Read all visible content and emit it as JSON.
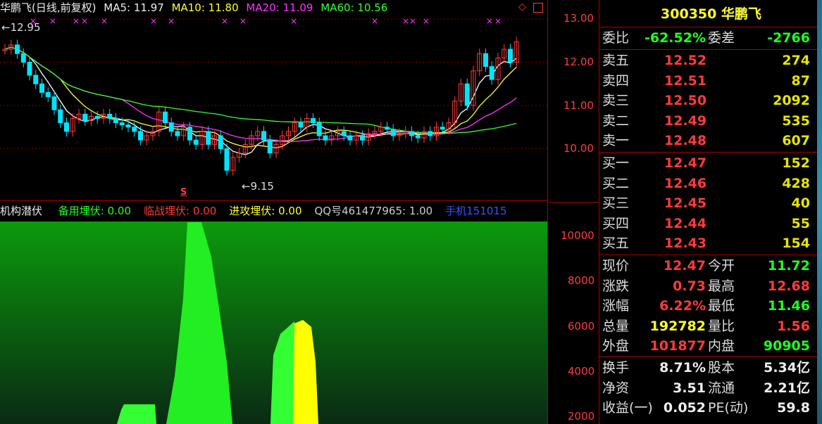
{
  "header": {
    "title": "华鹏飞(日线,前复权)",
    "ma5": "MA5: 11.97",
    "ma10": "MA10: 11.80",
    "ma20": "MA20: 11.09",
    "ma60": "MA60: 10.56",
    "high_marker": "12.95",
    "low_marker": "9.15",
    "s_marker": "S"
  },
  "axis": {
    "price_ticks": [
      "13.00",
      "12.00",
      "11.00",
      "10.00"
    ],
    "ind_ticks": [
      "10000",
      "8000",
      "6000",
      "4000",
      "2000"
    ]
  },
  "indicator": {
    "name": "机构潜伏",
    "items": [
      {
        "label": "备用埋伏: 0.00",
        "color": "#22ff22"
      },
      {
        "label": "临战埋伏: 0.00",
        "color": "#ff3b3b"
      },
      {
        "label": "进攻埋伏: 0.00",
        "color": "#ffff33"
      },
      {
        "label": "QQ号461477965: 1.00",
        "color": "#cccccc"
      },
      {
        "label": "手机151015",
        "color": "#3355ff"
      }
    ]
  },
  "quote": {
    "code_name": "300350 华鹏飞",
    "weibi_label": "委比",
    "weibi_value": "-62.52%",
    "weicha_label": "委差",
    "weicha_value": "-2766",
    "asks": [
      {
        "label": "卖五",
        "price": "12.52",
        "vol": "274"
      },
      {
        "label": "卖四",
        "price": "12.51",
        "vol": "87"
      },
      {
        "label": "卖三",
        "price": "12.50",
        "vol": "2092"
      },
      {
        "label": "卖二",
        "price": "12.49",
        "vol": "535"
      },
      {
        "label": "卖一",
        "price": "12.48",
        "vol": "607"
      }
    ],
    "bids": [
      {
        "label": "买一",
        "price": "12.47",
        "vol": "152"
      },
      {
        "label": "买二",
        "price": "12.46",
        "vol": "428"
      },
      {
        "label": "买三",
        "price": "12.45",
        "vol": "40"
      },
      {
        "label": "买四",
        "price": "12.44",
        "vol": "55"
      },
      {
        "label": "买五",
        "price": "12.43",
        "vol": "154"
      }
    ],
    "stats": [
      {
        "l1": "现价",
        "v1": "12.47",
        "c1": "red",
        "l2": "今开",
        "v2": "11.72",
        "c2": "green"
      },
      {
        "l1": "涨跌",
        "v1": "0.73",
        "c1": "red",
        "l2": "最高",
        "v2": "12.68",
        "c2": "red"
      },
      {
        "l1": "涨幅",
        "v1": "6.22%",
        "c1": "red",
        "l2": "最低",
        "v2": "11.46",
        "c2": "green"
      },
      {
        "l1": "总量",
        "v1": "192782",
        "c1": "yellow",
        "l2": "量比",
        "v2": "1.56",
        "c2": "red"
      },
      {
        "l1": "外盘",
        "v1": "101877",
        "c1": "red",
        "l2": "内盘",
        "v2": "90905",
        "c2": "green"
      }
    ],
    "fin": [
      {
        "l1": "换手",
        "v1": "8.71%",
        "l2": "股本",
        "v2": "5.34亿"
      },
      {
        "l1": "净资",
        "v1": "3.51",
        "l2": "流通",
        "v2": "2.21亿"
      },
      {
        "l1": "收益(一)",
        "v1": "0.052",
        "l2": "PE(动)",
        "v2": "59.8"
      }
    ]
  }
}
